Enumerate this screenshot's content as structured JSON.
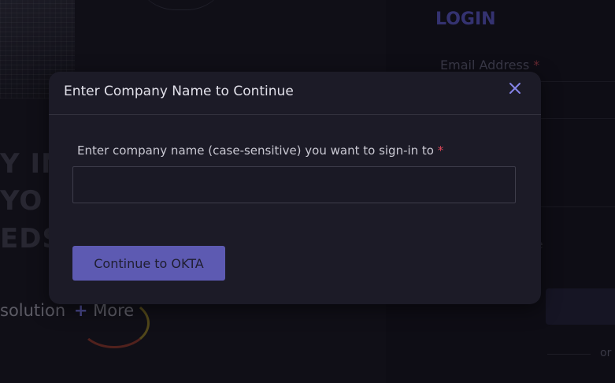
{
  "background": {
    "hero_lines": [
      "Y IN",
      "YO",
      "EDS"
    ],
    "hero_bottom_text": "solution",
    "hero_more_plus": "+",
    "hero_more_text": "More",
    "login_title": "LOGIN",
    "email_label": "Email Address",
    "required_marker": "*",
    "login_fragment": "ne",
    "or_text": "or"
  },
  "modal": {
    "title": "Enter Company Name to Continue",
    "close_icon": "close-icon",
    "field_label": "Enter company name (case-sensitive) you want to sign-in to",
    "required_marker": "*",
    "input_value": "",
    "input_placeholder": "",
    "button_label": "Continue to OKTA"
  },
  "colors": {
    "accent": "#5d5ab2",
    "modal_bg": "#1c1b27",
    "required": "#e0485a",
    "close_icon": "#8583e8"
  }
}
